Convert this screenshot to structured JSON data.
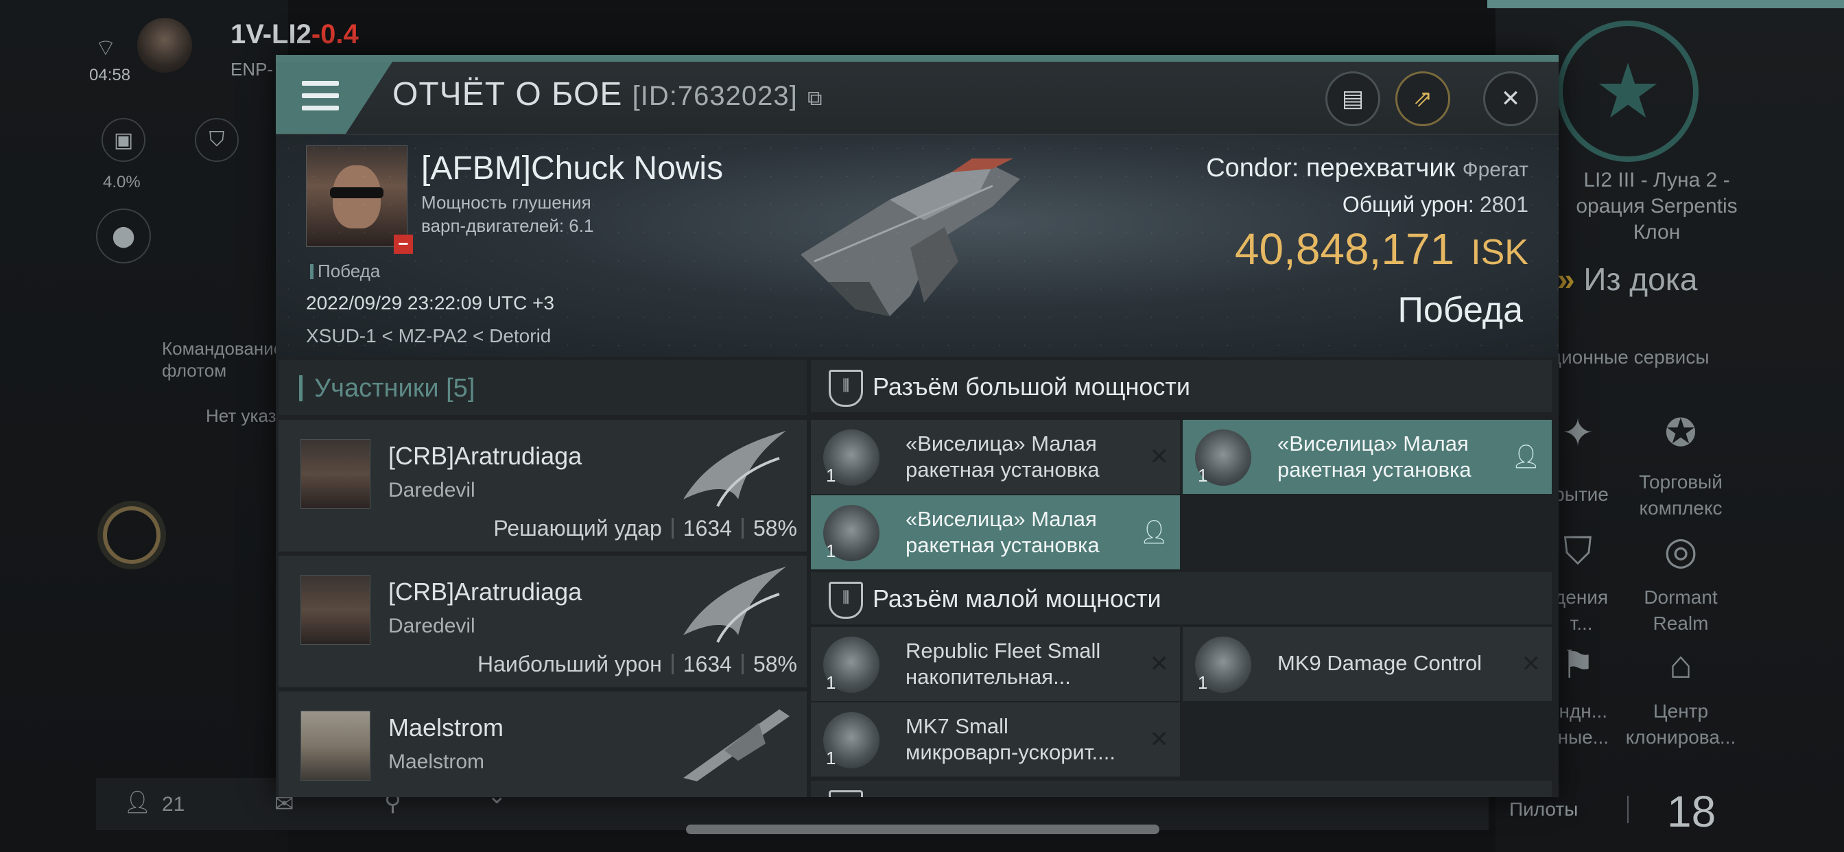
{
  "background": {
    "hud_time": "04:58",
    "system_name": "1V-LI2",
    "system_security": "-0.4",
    "region_abbr": "ENP-",
    "progress_label": "4.0%",
    "fleet_command_label": "Командование\nфлотом",
    "not_specified_label": "Нет указ",
    "bottom_count": "21",
    "station_text": "LI2 III - Луна 2 -\nорация Serpentis\nКлон",
    "undock_label": "Из дока",
    "services_label": "ционные сервисы",
    "tile_labels": [
      "рытие",
      "Торговый\nкомплекс",
      "дения\nт...",
      "Dormant\nRealm",
      "андн...\nиные...",
      "Центр\nклонирова..."
    ],
    "pilots_label": "Пилоты",
    "pilots_count": "18"
  },
  "dialog": {
    "title": "ОТЧЁТ О БОЕ",
    "report_id": "[ID:7632023]",
    "icons": {
      "menu": "menu-icon",
      "copy": "copy-icon",
      "document": "document-icon",
      "share": "share-icon",
      "close": "close-icon"
    }
  },
  "victim": {
    "name": "[AFBM]Chuck Nowis",
    "warp_disruption_label": "Мощность глушения\nварп-двигателей: 6.1",
    "result_small": "Победа",
    "datetime": "2022/09/29 23:22:09 UTC +3",
    "location": "XSUD-1 < MZ-PA2 < Detorid",
    "ship_name": "Condor: перехватчик",
    "ship_class": "Фрегат",
    "total_damage_label": "Общий урон:",
    "total_damage_value": "2801",
    "isk_value": "40,848,171",
    "isk_unit": "ISK",
    "result_big": "Победа"
  },
  "participants": {
    "header": "Участники [5]",
    "rows": [
      {
        "name": "[CRB]Aratrudiaga",
        "ship": "Daredevil",
        "role": "Решающий удар",
        "damage": "1634",
        "percent": "58%"
      },
      {
        "name": "[CRB]Aratrudiaga",
        "ship": "Daredevil",
        "role": "Наибольший урон",
        "damage": "1634",
        "percent": "58%"
      },
      {
        "name": "Maelstrom",
        "ship": "Maelstrom",
        "role": "",
        "damage": "",
        "percent": ""
      }
    ]
  },
  "fittings": {
    "high_slot_header": "Разъём большой мощности",
    "high_slots": [
      {
        "label": "«Виселица» Малая\nракетная установка",
        "qty": "1",
        "state": "destroyed"
      },
      {
        "label": "«Виселица» Малая\nракетная установка",
        "qty": "1",
        "state": "dropped"
      },
      {
        "label": "«Виселица» Малая\nракетная установка",
        "qty": "1",
        "state": "dropped"
      }
    ],
    "low_slot_header": "Разъём малой мощности",
    "low_slots": [
      {
        "label": "Republic Fleet Small\nнакопительная...",
        "qty": "1",
        "state": "destroyed"
      },
      {
        "label": "MK9 Damage Control",
        "qty": "1",
        "state": "destroyed"
      },
      {
        "label": "MK7 Small\nмикроварп-ускорит....",
        "qty": "1",
        "state": "destroyed"
      }
    ]
  }
}
